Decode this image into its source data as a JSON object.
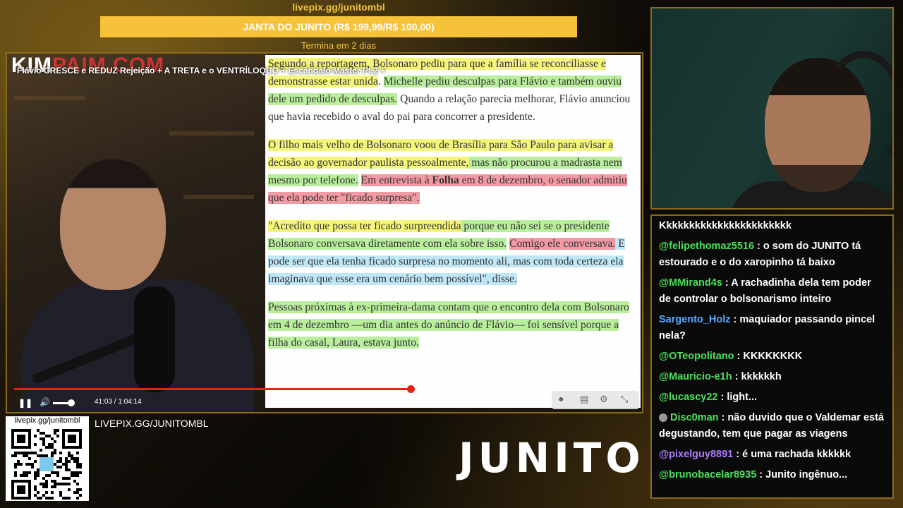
{
  "goal": {
    "url": "livepix.gg/junitombl",
    "title": "JANTA DO JUNITO (R$ 199,99/R$ 100,00)",
    "time_left": "Termina em 2 dias",
    "progress": 1.0
  },
  "video": {
    "logo_a": "KIM",
    "logo_b": "PAIM.COM",
    "title": "Flávio CRESCE e REDUZ Rejeição + A TRETA e o VENTRÍLOQUO + Escândalo Master Pt.2 +",
    "elapsed": "41:03",
    "duration": "1:04:14",
    "time_label": "41:03 / 1:04:14",
    "progress": 0.639
  },
  "article": {
    "p1": [
      {
        "t": "Segundo a reportagem, Bolsonaro pediu para que a família se reconciliasse e ",
        "h": "hy"
      },
      {
        "t": "demonstrasse estar unida",
        "h": "hy"
      },
      {
        "t": ". ",
        "h": ""
      },
      {
        "t": "Michelle pediu desculpas para Flávio e também ouviu dele um pedido de desculpas.",
        "h": "hg"
      },
      {
        "t": " Quando a relação parecia melhorar, Flávio anunciou que havia recebido o aval do pai para concorrer a presidente.",
        "h": ""
      }
    ],
    "p2": [
      {
        "t": "O filho mais velho de Bolsonaro voou de Brasília para São Paulo para avisar a decisão ao governador paulista pessoalmente,",
        "h": "hy"
      },
      {
        "t": " mas não procurou a madrasta nem mesmo por telefone.",
        "h": "hg"
      },
      {
        "t": " ",
        "h": ""
      },
      {
        "t": "Em entrevista à ",
        "h": "hr"
      },
      {
        "t": "Folha",
        "h": "hr it"
      },
      {
        "t": " em 8 de dezembro, o senador admitiu que ela pode ter \"ficado surpresa\".",
        "h": "hr"
      }
    ],
    "p3": [
      {
        "t": "\"Acredito que possa ter ficado surpreendida",
        "h": "hy"
      },
      {
        "t": " porque eu não sei se o presidente Bolsonaro conversava diretamente com ela sobre isso.",
        "h": "hg"
      },
      {
        "t": " ",
        "h": ""
      },
      {
        "t": "Comigo ele conversava.",
        "h": "hr"
      },
      {
        "t": " E pode ser que ela tenha ficado surpresa no momento ali, mas com toda certeza ela imaginava que esse era um cenário bem possível\", disse.",
        "h": "hb"
      }
    ],
    "p4": [
      {
        "t": "Pessoas próximas à ex-primeira-dama contam que o encontro dela com Bolsonaro em 4 de dezembro —um dia antes do anúncio de Flávio— foi sensível porque a filha do casal, Laura, estava junto.",
        "h": "hg"
      }
    ]
  },
  "chat": [
    {
      "user": "",
      "text": "Kkkkkkkkkkkkkkkkkkkkkkk",
      "color": "#4ae25a"
    },
    {
      "user": "@felipethomaz5516",
      "text": "o som do JUNITO tá estourado e o do xaropinho tá baixo",
      "color": "#4ae25a"
    },
    {
      "user": "@MMirand4s",
      "text": "A rachadinha dela tem poder de controlar o bolsonarismo inteiro",
      "color": "#4ae25a"
    },
    {
      "user": "Sargento_Holz",
      "text": "maquiador passando pincel nela?",
      "color": "#5aa9ff"
    },
    {
      "user": "@OTeopolitano",
      "text": "KKKKKKKK",
      "color": "#4ae25a"
    },
    {
      "user": "@Mauricio-e1h",
      "text": "kkkkkkh",
      "color": "#4ae25a"
    },
    {
      "user": "@lucascy22",
      "text": "light...",
      "color": "#4ae25a"
    },
    {
      "user": "Disc0man",
      "text": "não duvido que o Valdemar está degustando, tem que pagar as viagens",
      "color": "#4ae25a",
      "badge": true
    },
    {
      "user": "@pixelguy8891",
      "text": "é uma rachada kkkkkk",
      "color": "#b07cff"
    },
    {
      "user": "@brunobacelar8935",
      "text": "Junito ingênuo...",
      "color": "#4ae25a"
    }
  ],
  "bottom": {
    "qr_label": "livepix.gg/junitombl",
    "livepix": "LIVEPIX.GG/JUNITOMBL",
    "logo": "JUNITO"
  }
}
